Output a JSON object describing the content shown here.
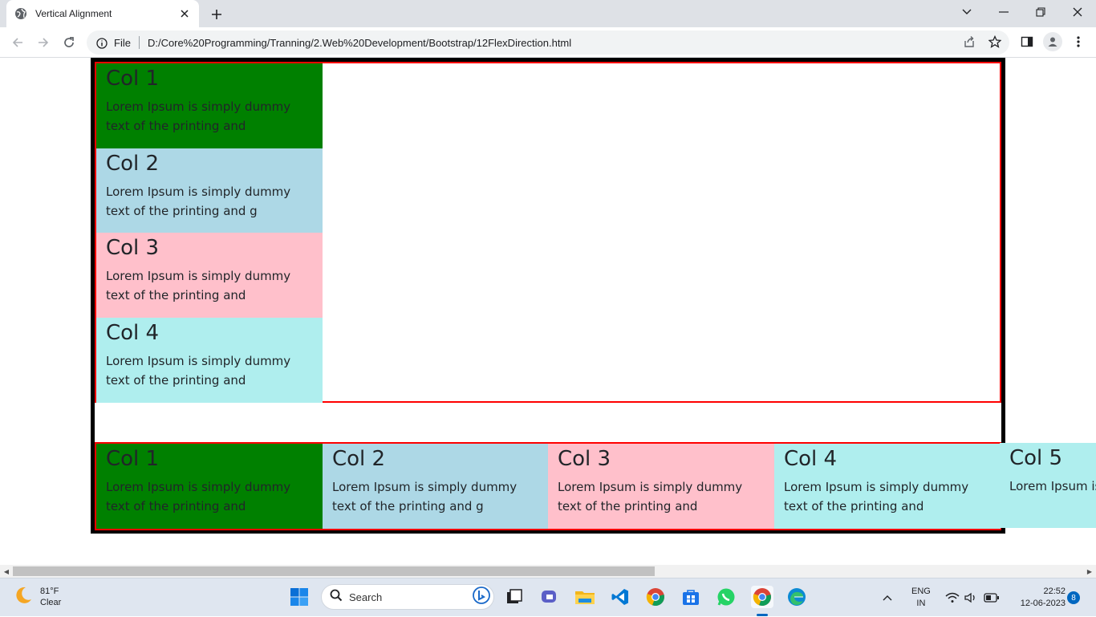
{
  "browser": {
    "tab_title": "Vertical Alignment",
    "omnibox_scheme": "File",
    "url": "D:/Core%20Programming/Tranning/2.Web%20Development/Bootstrap/12FlexDirection.html"
  },
  "page": {
    "column_section": {
      "cards": [
        {
          "title": "Col 1",
          "text": "Lorem Ipsum is simply dummy text of the printing and",
          "color": "#008000"
        },
        {
          "title": "Col 2",
          "text": "Lorem Ipsum is simply dummy text of the printing and g",
          "color": "#add8e6"
        },
        {
          "title": "Col 3",
          "text": "Lorem Ipsum is simply dummy text of the printing and",
          "color": "#ffc0cb"
        },
        {
          "title": "Col 4",
          "text": "Lorem Ipsum is simply dummy text of the printing and",
          "color": "#afeeee"
        }
      ]
    },
    "row_section": {
      "cards": [
        {
          "title": "Col 1",
          "text": "Lorem Ipsum is simply dummy text of the printing and",
          "color": "#008000"
        },
        {
          "title": "Col 2",
          "text": "Lorem Ipsum is simply dummy text of the printing and g",
          "color": "#add8e6"
        },
        {
          "title": "Col 3",
          "text": "Lorem Ipsum is simply dummy text of the printing and",
          "color": "#ffc0cb"
        },
        {
          "title": "Col 4",
          "text": "Lorem Ipsum is simply dummy text of the printing and",
          "color": "#afeeee"
        },
        {
          "title": "Col 5",
          "text": "Lorem Ipsum is",
          "color": "#afeeee"
        }
      ]
    }
  },
  "taskbar": {
    "weather_temp": "81°F",
    "weather_desc": "Clear",
    "search_label": "Search",
    "lang_line1": "ENG",
    "lang_line2": "IN",
    "time": "22:52",
    "date": "12-06-2023",
    "notification_count": "8"
  }
}
